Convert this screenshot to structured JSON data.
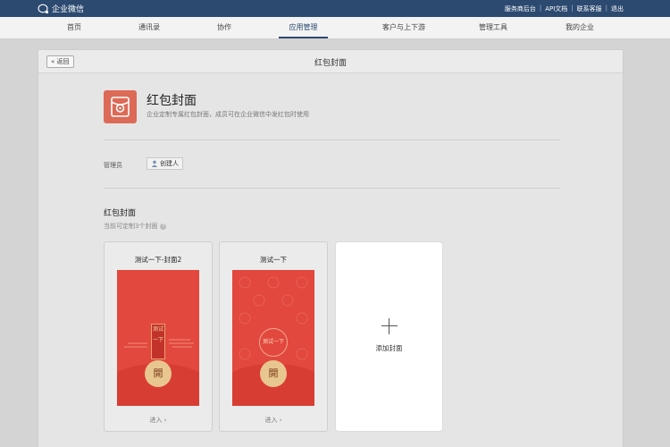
{
  "topbar": {
    "logo_text": "企业微信",
    "links": [
      "服务商后台",
      "API文档",
      "联系客服",
      "退出"
    ]
  },
  "nav": {
    "items": [
      "首页",
      "通讯录",
      "协作",
      "应用管理",
      "客户与上下游",
      "管理工具",
      "我的企业"
    ],
    "active_index": 3
  },
  "panel": {
    "back_label": "返回",
    "title": "红包封面"
  },
  "app": {
    "title": "红包封面",
    "description": "企业定制专属红包封面，成员可在企业微信中发红包时使用"
  },
  "admin": {
    "label": "管理员",
    "chip": "创建人"
  },
  "section": {
    "title": "红包封面",
    "subtitle": "当前可定制3个封面"
  },
  "cards": [
    {
      "name": "测试一下-封面2",
      "cover_text": "测试一下",
      "open_char": "開",
      "enter_label": "进入 ›"
    },
    {
      "name": "测试一下",
      "cover_text": "测试一下",
      "open_char": "開",
      "enter_label": "进入 ›"
    }
  ],
  "add_card": {
    "label": "添加封面"
  },
  "colors": {
    "topbar": "#2c4a70",
    "cover_red": "#e2483d",
    "open_gold": "#e8c690",
    "app_icon": "#dc6a57"
  }
}
